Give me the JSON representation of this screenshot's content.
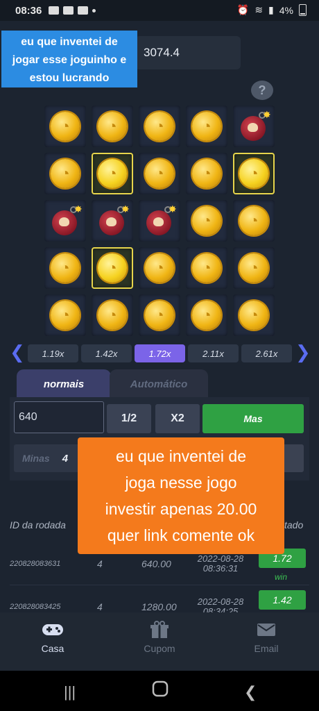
{
  "status_bar": {
    "time": "08:36",
    "battery": "4%"
  },
  "game": {
    "balance": "3074.4",
    "help_label": "?",
    "grid": [
      [
        "coin",
        "coin",
        "coin",
        "coin",
        "bomb"
      ],
      [
        "coin",
        "coin-selected",
        "coin",
        "coin",
        "coin-selected"
      ],
      [
        "bomb",
        "bomb",
        "bomb",
        "coin",
        "coin"
      ],
      [
        "coin",
        "coin-selected",
        "coin",
        "coin",
        "coin"
      ],
      [
        "coin",
        "coin",
        "coin",
        "coin",
        "coin"
      ]
    ],
    "multipliers": [
      "1.19x",
      "1.42x",
      "1.72x",
      "2.11x",
      "2.61x"
    ],
    "active_multiplier_index": 2
  },
  "tabs": {
    "manual": "normais",
    "auto": "Automático"
  },
  "controls": {
    "bet_value": "640",
    "half_label": "1/2",
    "double_label": "X2",
    "mas_label": "Mas",
    "mines_label": "Minas",
    "mines_value": "4"
  },
  "history": {
    "col_round": "ID da rodada",
    "col_result_partial": "tado",
    "rows": [
      {
        "id": "220828083631",
        "mines": "4",
        "amount": "640.00",
        "date": "2022-08-28",
        "time": "08:36:31",
        "result": "1.72",
        "status": "win"
      },
      {
        "id": "220828083425",
        "mines": "4",
        "amount": "1280.00",
        "date": "2022-08-28",
        "time": "08:34:25",
        "result": "1.42"
      }
    ]
  },
  "captions": {
    "top": [
      "eu que inventei de",
      "jogar esse joguinho  e",
      "estou lucrando"
    ],
    "middle": [
      "eu que inventei de",
      "joga nesse jogo",
      "investir apenas 20.00",
      "quer link comente ok"
    ]
  },
  "nav": {
    "home": "Casa",
    "coupon": "Cupom",
    "email": "Email"
  },
  "colors": {
    "accent_purple": "#7b64e8",
    "green": "#2fa143",
    "caption_orange": "#f47a1c",
    "caption_blue": "#2c8ce2"
  }
}
